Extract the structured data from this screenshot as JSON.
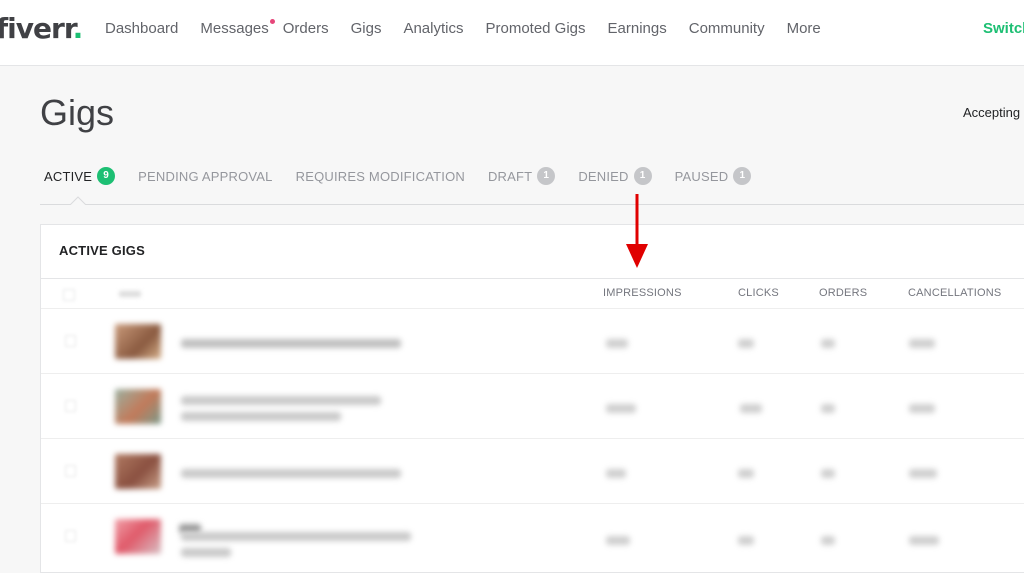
{
  "header": {
    "logo_text": "fiverr",
    "logo_dot": ".",
    "nav": [
      {
        "label": "Dashboard"
      },
      {
        "label": "Messages"
      },
      {
        "label": "Orders"
      },
      {
        "label": "Gigs"
      },
      {
        "label": "Analytics"
      },
      {
        "label": "Promoted Gigs"
      },
      {
        "label": "Earnings"
      },
      {
        "label": "Community"
      },
      {
        "label": "More"
      }
    ],
    "switch_label": "Switch"
  },
  "page": {
    "title": "Gigs",
    "accepting_label": "Accepting"
  },
  "tabs": [
    {
      "label": "ACTIVE",
      "count": "9"
    },
    {
      "label": "PENDING APPROVAL"
    },
    {
      "label": "REQUIRES MODIFICATION"
    },
    {
      "label": "DRAFT",
      "count": "1"
    },
    {
      "label": "DENIED",
      "count": "1"
    },
    {
      "label": "PAUSED",
      "count": "1"
    }
  ],
  "table": {
    "title": "ACTIVE GIGS",
    "columns": [
      "IMPRESSIONS",
      "CLICKS",
      "ORDERS",
      "CANCELLATIONS"
    ]
  },
  "colors": {
    "brand": "#1dbf73",
    "notification": "#e6467a",
    "annotation_arrow": "#e00000"
  },
  "icons": {
    "annotation": "red-down-arrow-icon"
  }
}
